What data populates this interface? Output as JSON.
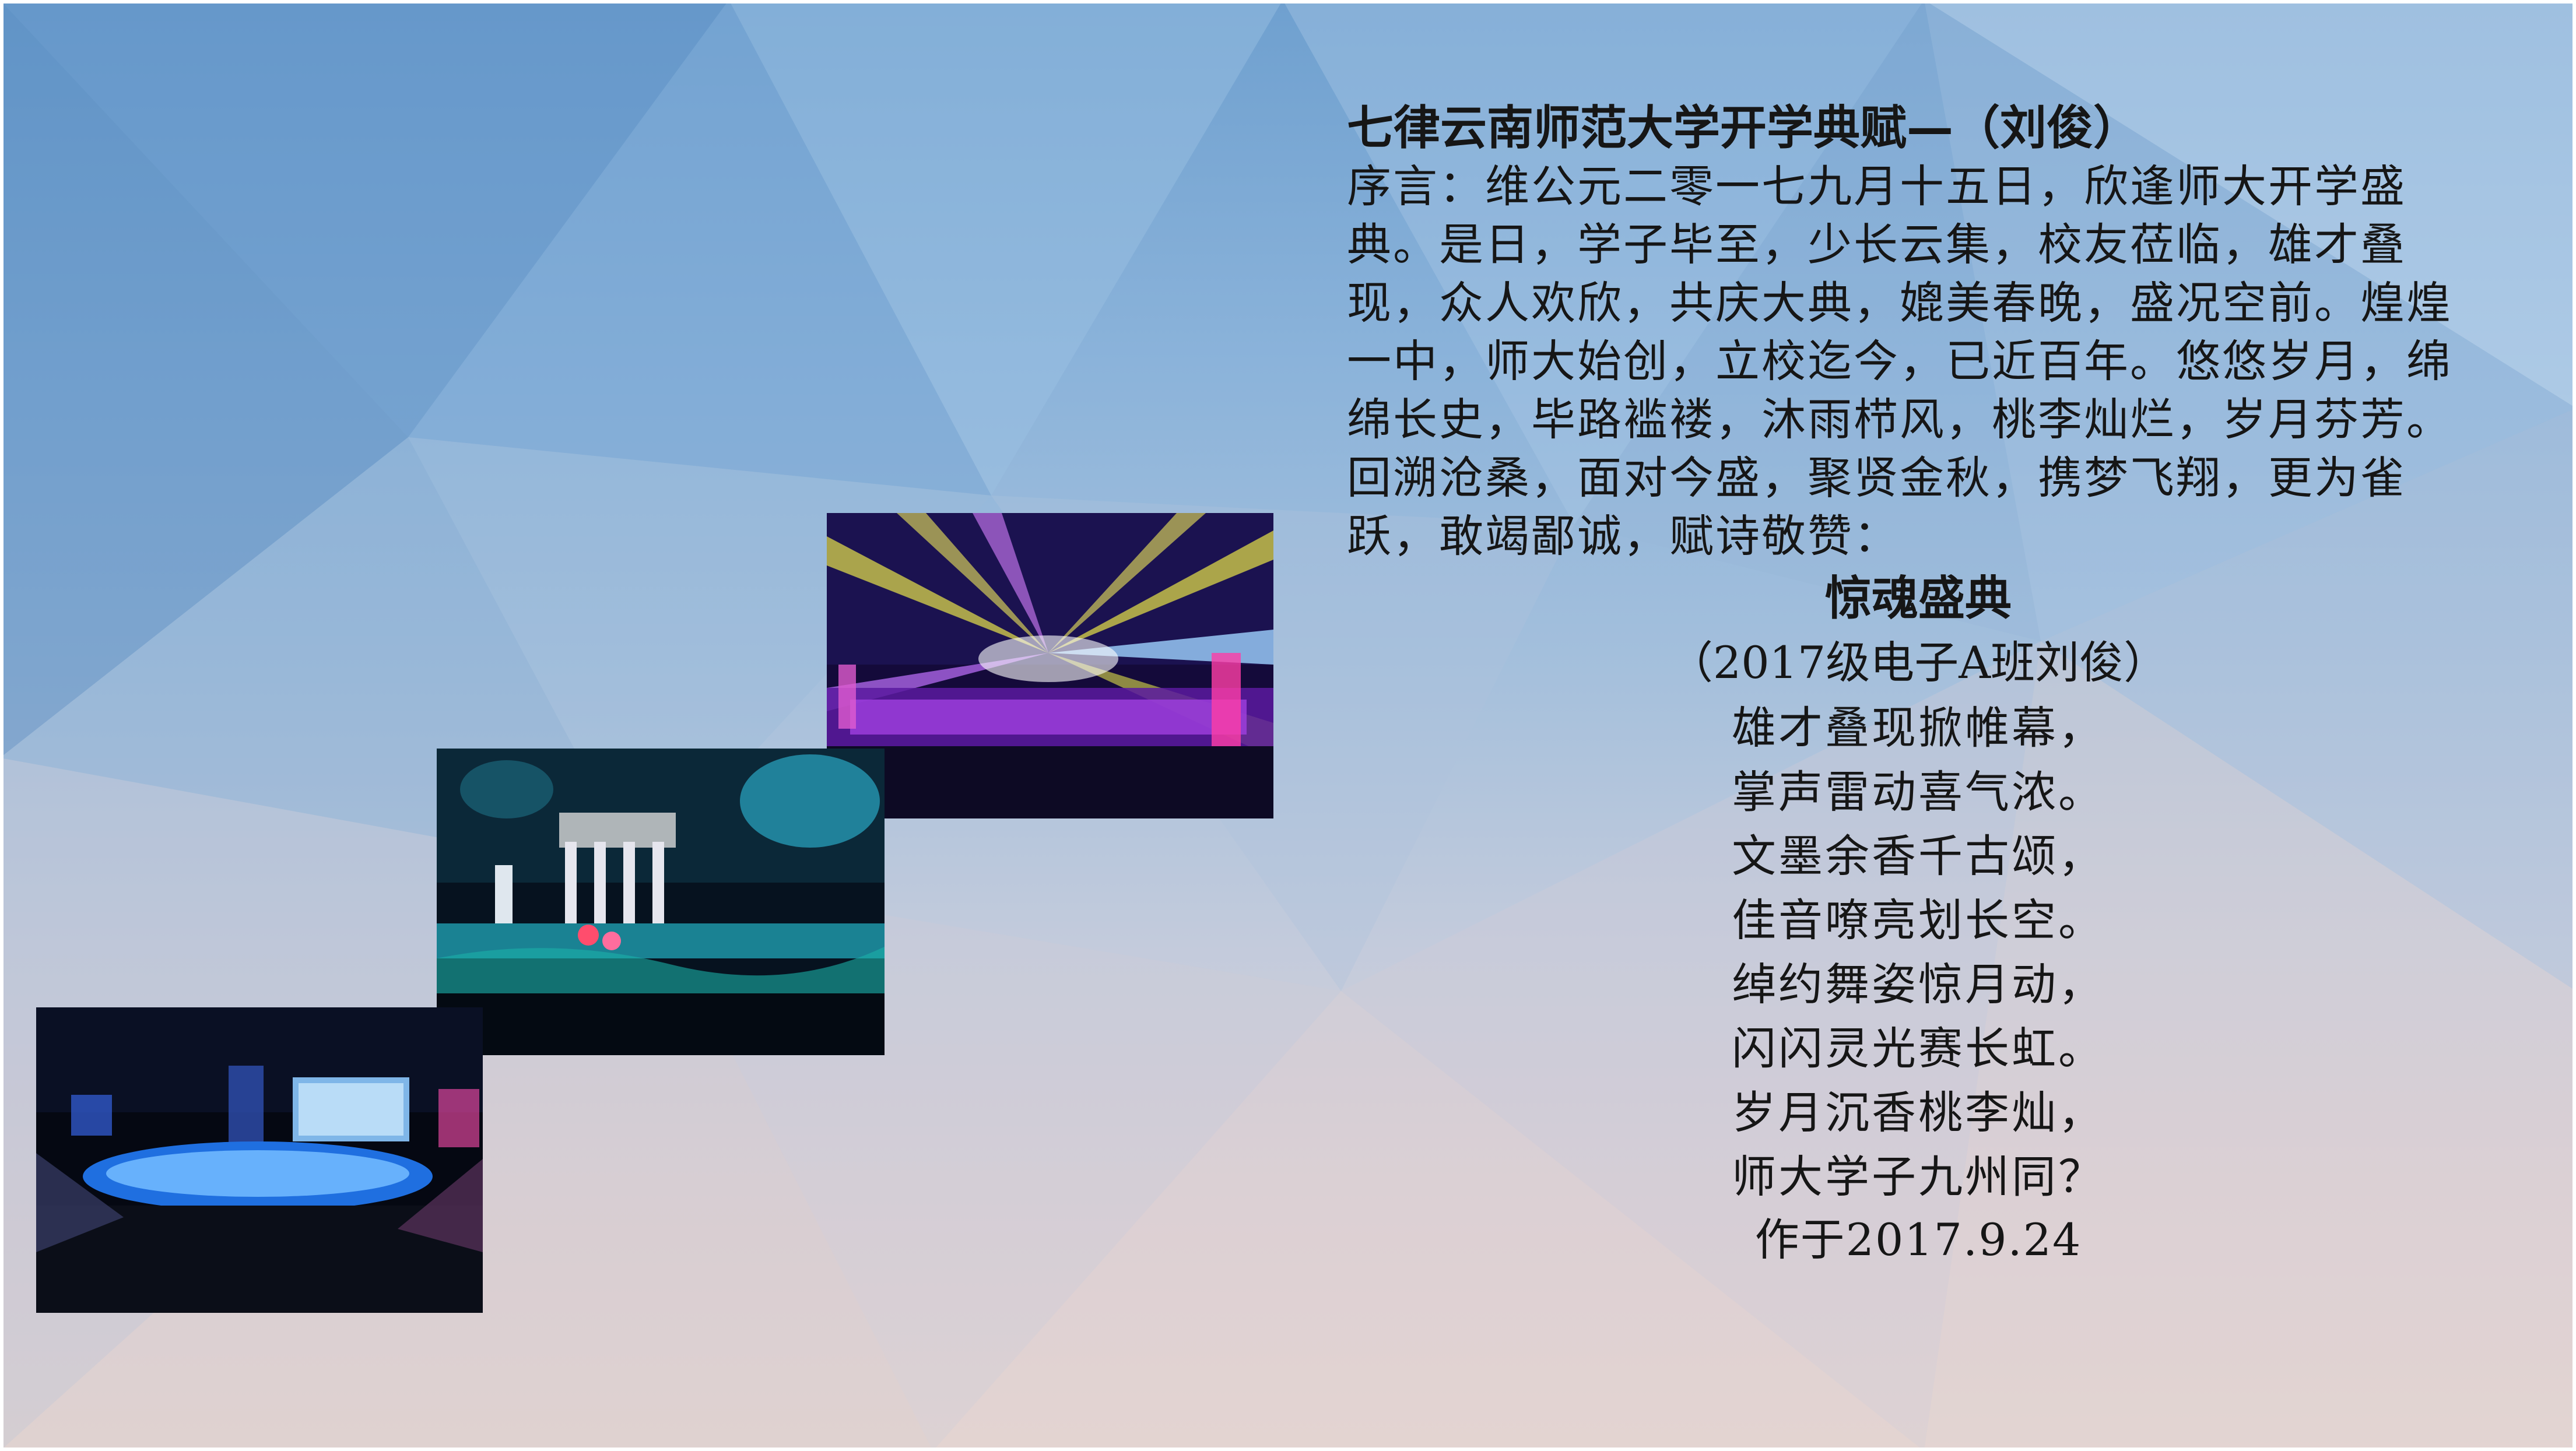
{
  "slide": {
    "colors": {
      "background_top": "#6fa0cf",
      "background_bottom": "#e4d6d2",
      "frame": "#ffffff",
      "text": "#161616"
    },
    "title": "七律云南师范大学开学典赋—（刘俊）",
    "preface": "序言：维公元二零一七九月十五日，欣逢师大开学盛典。是日，学子毕至，少长云集，校友莅临，雄才叠现，众人欢欣，共庆大典，媲美春晚，盛况空前。煌煌一中，师大始创，立校迄今，已近百年。悠悠岁月，绵绵长史，毕路褴褛，沐雨栉风，桃李灿烂，岁月芬芳。回溯沧桑，面对今盛，聚贤金秋，携梦飞翔，更为雀跃，敢竭鄙诚，赋诗敬赞：",
    "poem": {
      "title": "惊魂盛典",
      "author": "（2017级电子A班刘俊）",
      "lines": [
        "雄才叠现掀帷幕，",
        "掌声雷动喜气浓。",
        "文墨余香千古颂，",
        "佳音嘹亮划长空。",
        "绰约舞姿惊月动，",
        "闪闪灵光赛长虹。",
        "岁月沉香桃李灿，",
        "师大学子九州同？"
      ],
      "date": "作于2017.9.24"
    },
    "photos": [
      {
        "subject": "stage with purple and yellow laser beams",
        "icon": "concert-photo"
      },
      {
        "subject": "stage performers with teal lights and signs",
        "icon": "concert-photo"
      },
      {
        "subject": "arena stage with blue lit platform and screens",
        "icon": "concert-photo"
      }
    ]
  }
}
